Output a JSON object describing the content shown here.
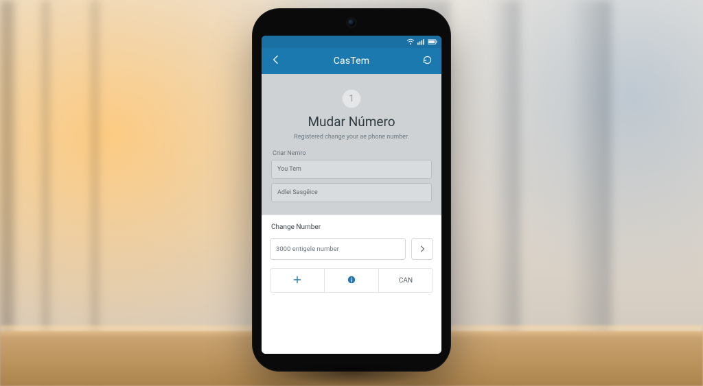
{
  "appbar": {
    "title": "CasTem"
  },
  "step": {
    "number": "1"
  },
  "page": {
    "title": "Mudar Número",
    "subtitle": "Registered change your ae phone number."
  },
  "fields": {
    "criar_label": "Criar Nemro",
    "criar_value": "You Tem",
    "second_value": "Adlei Sasgêice"
  },
  "sheet": {
    "label": "Change Number",
    "number_placeholder": "3000 entigele number",
    "can_label": "CAN"
  },
  "colors": {
    "brand": "#1f78ad"
  }
}
